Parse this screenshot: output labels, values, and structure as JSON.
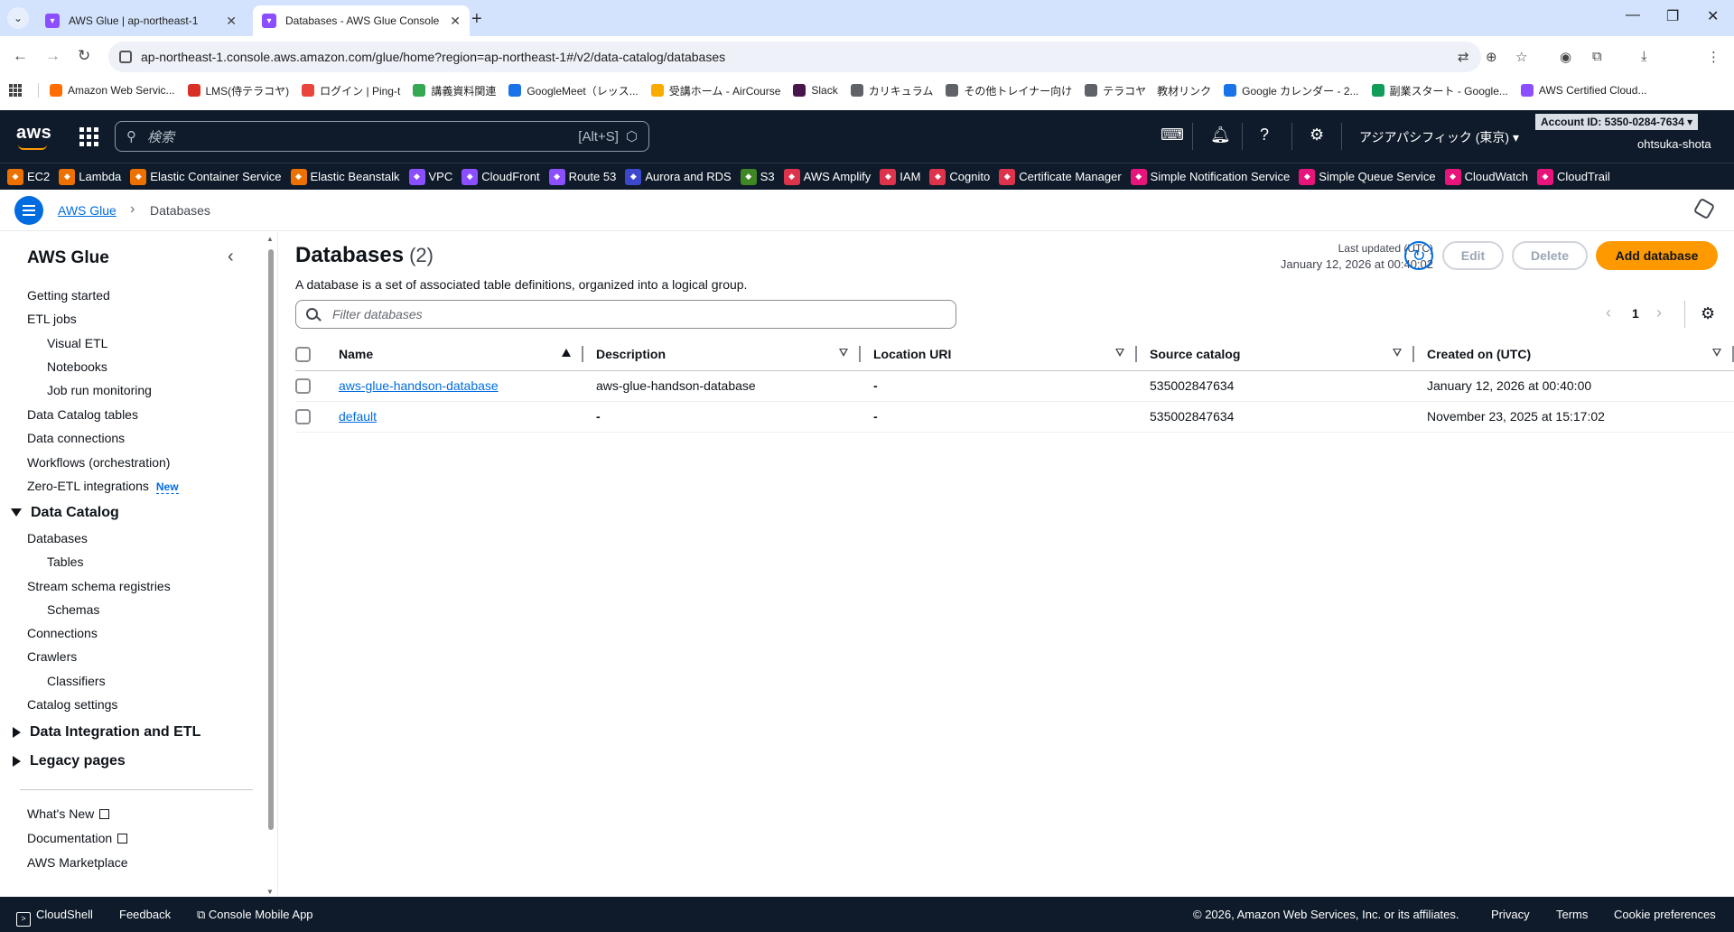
{
  "browser": {
    "tabs": [
      {
        "title": "AWS Glue | ap-northeast-1",
        "active": false
      },
      {
        "title": "Databases - AWS Glue Console",
        "active": true
      }
    ],
    "url": "ap-northeast-1.console.aws.amazon.com/glue/home?region=ap-northeast-1#/v2/data-catalog/databases",
    "bookmarks": [
      {
        "label": "Amazon Web Servic...",
        "color": "#ff6d00"
      },
      {
        "label": "LMS(侍テラコヤ)",
        "color": "#d93025"
      },
      {
        "label": "ログイン | Ping-t",
        "color": "#e8453c"
      },
      {
        "label": "講義資料関連",
        "color": "#34a853"
      },
      {
        "label": "GoogleMeet（レッス...",
        "color": "#1a73e8"
      },
      {
        "label": "受講ホーム - AirCourse",
        "color": "#f9ab00"
      },
      {
        "label": "Slack",
        "color": "#4a154b"
      },
      {
        "label": "カリキュラム",
        "color": "#5f6368"
      },
      {
        "label": "その他トレイナー向け",
        "color": "#5f6368"
      },
      {
        "label": "テラコヤ　教材リンク",
        "color": "#5f6368"
      },
      {
        "label": "Google カレンダー - 2...",
        "color": "#1a73e8"
      },
      {
        "label": "副業スタート - Google...",
        "color": "#0f9d58"
      },
      {
        "label": "AWS Certified Cloud...",
        "color": "#8c4fff"
      }
    ]
  },
  "awsnav": {
    "search_placeholder": "検索",
    "search_shortcut": "[Alt+S]",
    "region": "アジアパシフィック (東京)",
    "account": "Account ID: 5350-0284-7634",
    "user": "ohtsuka-shota"
  },
  "favorites": [
    {
      "label": "EC2",
      "color": "#ed7100"
    },
    {
      "label": "Lambda",
      "color": "#ed7100"
    },
    {
      "label": "Elastic Container Service",
      "color": "#ed7100"
    },
    {
      "label": "Elastic Beanstalk",
      "color": "#ed7100"
    },
    {
      "label": "VPC",
      "color": "#8c4fff"
    },
    {
      "label": "CloudFront",
      "color": "#8c4fff"
    },
    {
      "label": "Route 53",
      "color": "#8c4fff"
    },
    {
      "label": "Aurora and RDS",
      "color": "#3b48cc"
    },
    {
      "label": "S3",
      "color": "#3f8624"
    },
    {
      "label": "AWS Amplify",
      "color": "#dd344c"
    },
    {
      "label": "IAM",
      "color": "#dd344c"
    },
    {
      "label": "Cognito",
      "color": "#dd344c"
    },
    {
      "label": "Certificate Manager",
      "color": "#dd344c"
    },
    {
      "label": "Simple Notification Service",
      "color": "#e7157b"
    },
    {
      "label": "Simple Queue Service",
      "color": "#e7157b"
    },
    {
      "label": "CloudWatch",
      "color": "#e7157b"
    },
    {
      "label": "CloudTrail",
      "color": "#e7157b"
    }
  ],
  "breadcrumb": {
    "root": "AWS Glue",
    "current": "Databases"
  },
  "sidenav": {
    "title": "AWS Glue",
    "items": {
      "getting_started": "Getting started",
      "etl_jobs": "ETL jobs",
      "visual_etl": "Visual ETL",
      "notebooks": "Notebooks",
      "job_run_monitoring": "Job run monitoring",
      "data_catalog_tables": "Data Catalog tables",
      "data_connections": "Data connections",
      "workflows": "Workflows (orchestration)",
      "zero_etl": "Zero-ETL integrations",
      "new_badge": "New",
      "data_catalog": "Data Catalog",
      "databases": "Databases",
      "tables": "Tables",
      "stream_schema": "Stream schema registries",
      "schemas": "Schemas",
      "connections": "Connections",
      "crawlers": "Crawlers",
      "classifiers": "Classifiers",
      "catalog_settings": "Catalog settings",
      "data_integration": "Data Integration and ETL",
      "legacy": "Legacy pages",
      "whats_new": "What's New",
      "documentation": "Documentation",
      "marketplace": "AWS Marketplace"
    }
  },
  "main": {
    "title": "Databases",
    "count": "(2)",
    "description": "A database is a set of associated table definitions, organized into a logical group.",
    "last_updated_label": "Last updated (UTC)",
    "last_updated_value": "January 12, 2026 at 00:40:02",
    "edit": "Edit",
    "delete": "Delete",
    "add": "Add database",
    "filter_placeholder": "Filter databases",
    "page": "1",
    "columns": {
      "name": "Name",
      "description": "Description",
      "location": "Location URI",
      "source": "Source catalog",
      "created": "Created on (UTC)"
    },
    "rows": [
      {
        "name": "aws-glue-handson-database",
        "description": "aws-glue-handson-database",
        "location": "-",
        "source": "535002847634",
        "created": "January 12, 2026 at 00:40:00"
      },
      {
        "name": "default",
        "description": "-",
        "location": "-",
        "source": "535002847634",
        "created": "November 23, 2025 at 15:17:02"
      }
    ]
  },
  "footer": {
    "cloudshell": "CloudShell",
    "feedback": "Feedback",
    "mobile": "Console Mobile App",
    "copyright": "© 2026, Amazon Web Services, Inc. or its affiliates.",
    "privacy": "Privacy",
    "terms": "Terms",
    "cookies": "Cookie preferences"
  }
}
